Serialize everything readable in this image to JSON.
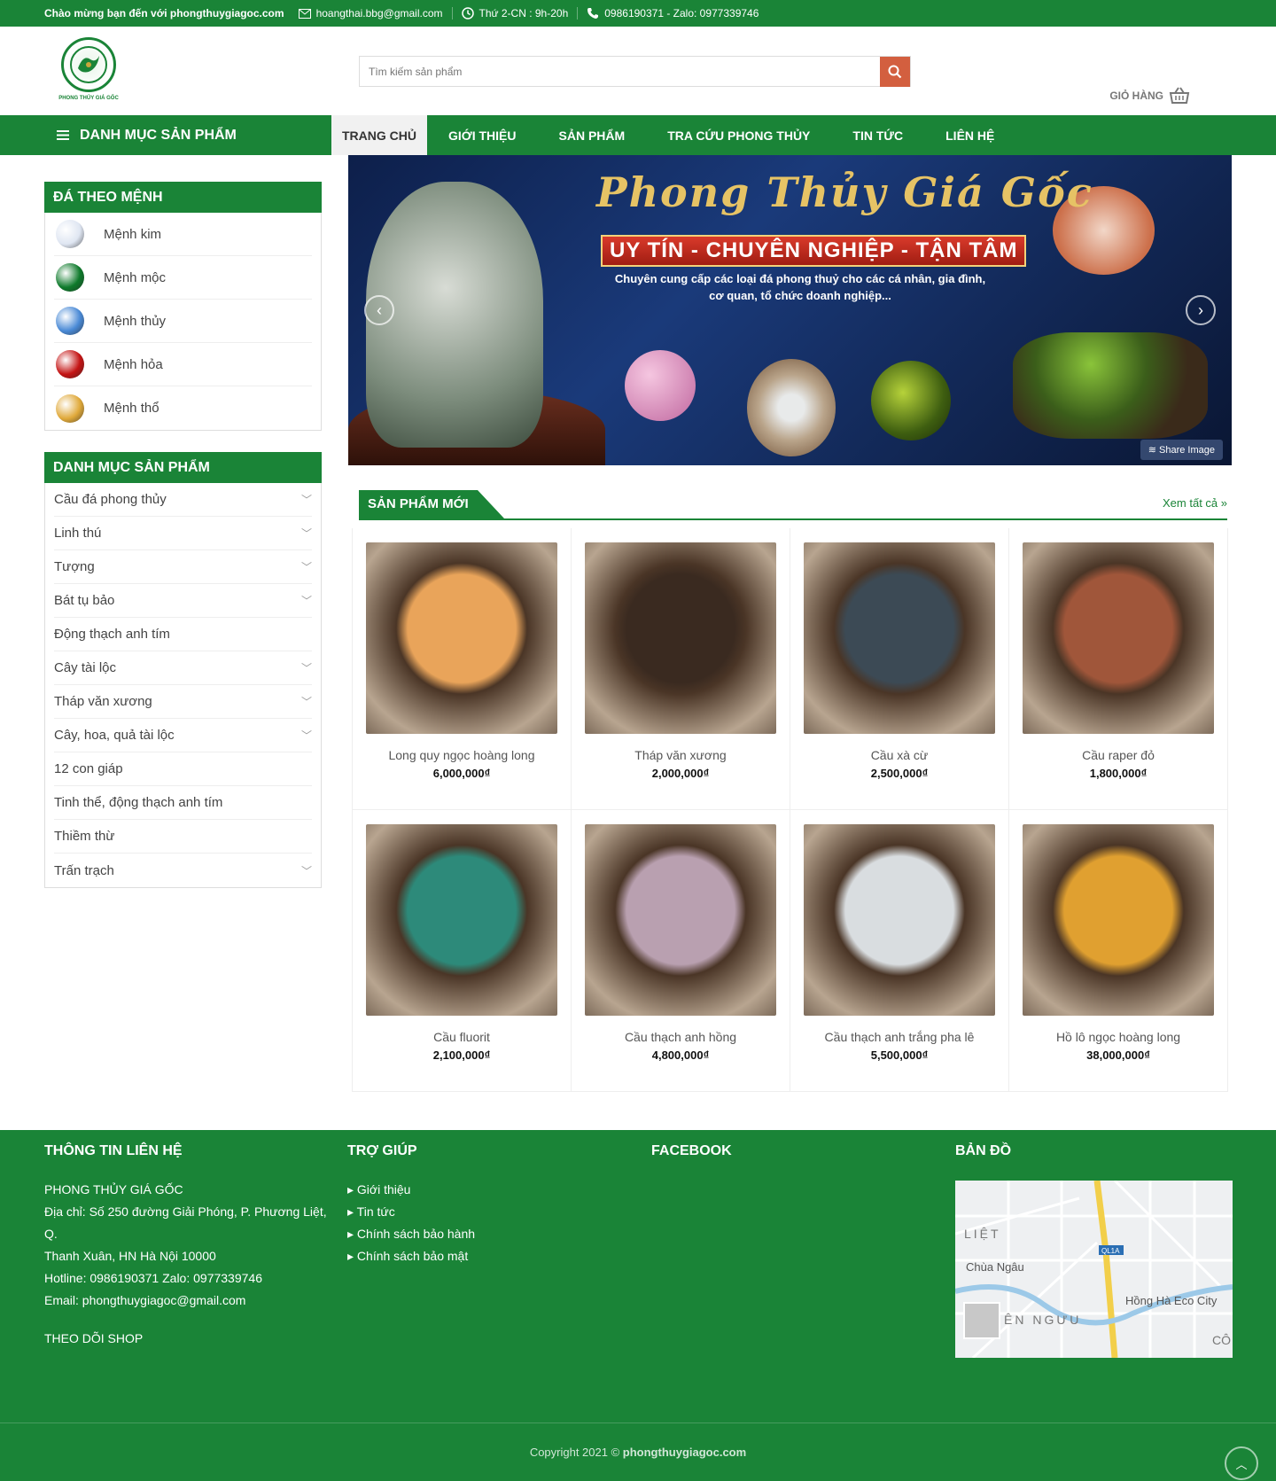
{
  "topbar": {
    "welcome": "Chào mừng bạn đến với phongthuygiagoc.com",
    "email": "hoangthai.bbg@gmail.com",
    "hours": "Thứ 2-CN : 9h-20h",
    "phone": "0986190371 - Zalo: 0977339746"
  },
  "header": {
    "search_placeholder": "Tìm kiếm sản phẩm",
    "cart_label": "GIỎ HÀNG",
    "logo_text": "PHONG THỦY GIÁ GỐC"
  },
  "nav": {
    "category_label": "DANH MỤC SẢN PHẨM",
    "items": [
      "TRANG CHỦ",
      "GIỚI THIỆU",
      "SẢN PHẨM",
      "TRA CỨU PHONG THỦY",
      "TIN TỨC",
      "LIÊN HỆ"
    ]
  },
  "sidebar": {
    "menh_title": "ĐÁ THEO MỆNH",
    "menh": [
      {
        "label": "Mệnh kim",
        "color": "#dfe6f2"
      },
      {
        "label": "Mệnh mộc",
        "color": "#0e7a2b"
      },
      {
        "label": "Mệnh thủy",
        "color": "#4a8ad6"
      },
      {
        "label": "Mệnh hỏa",
        "color": "#c41414"
      },
      {
        "label": "Mệnh thổ",
        "color": "#e0a93a"
      }
    ],
    "cat_title": "DANH MỤC SẢN PHẨM",
    "categories": [
      {
        "label": "Cầu đá phong thủy",
        "expand": true
      },
      {
        "label": "Linh thú",
        "expand": true
      },
      {
        "label": "Tượng",
        "expand": true
      },
      {
        "label": "Bát tụ bảo",
        "expand": true
      },
      {
        "label": "Động thạch anh tím",
        "expand": false
      },
      {
        "label": "Cây tài lộc",
        "expand": true
      },
      {
        "label": "Tháp văn xương",
        "expand": true
      },
      {
        "label": "Cây, hoa, quả tài lộc",
        "expand": true
      },
      {
        "label": "12 con giáp",
        "expand": false
      },
      {
        "label": "Tinh thể, động thạch anh tím",
        "expand": false
      },
      {
        "label": "Thiềm thừ",
        "expand": false
      },
      {
        "label": "Trấn trạch",
        "expand": true
      }
    ]
  },
  "banner": {
    "title": "Phong Thủy Giá Gốc",
    "slogan": "UY TÍN - CHUYÊN NGHIỆP - TẬN TÂM",
    "desc": "Chuyên cung cấp các loại đá phong thuỷ cho các cá nhân, gia đình, cơ quan, tổ chức doanh nghiệp...",
    "share": "Share Image"
  },
  "new_products": {
    "title": "SẢN PHẨM MỚI",
    "see_all": "Xem tất cả »",
    "items": [
      {
        "name": "Long quy ngọc hoàng long",
        "price": "6,000,000₫",
        "color": "#e9a45a"
      },
      {
        "name": "Tháp văn xương",
        "price": "2,000,000₫",
        "color": "#3a2a20"
      },
      {
        "name": "Cầu xà cừ",
        "price": "2,500,000₫",
        "color": "#3c4a55"
      },
      {
        "name": "Cầu raper đỏ",
        "price": "1,800,000₫",
        "color": "#a0563a"
      },
      {
        "name": "Cầu fluorit",
        "price": "2,100,000₫",
        "color": "#2d8a7a"
      },
      {
        "name": "Cầu thạch anh hồng",
        "price": "4,800,000₫",
        "color": "#b9a0b0"
      },
      {
        "name": "Cầu thạch anh trắng pha lê",
        "price": "5,500,000₫",
        "color": "#d9dde0"
      },
      {
        "name": "Hồ lô ngọc hoàng long",
        "price": "38,000,000₫",
        "color": "#e0a030"
      }
    ]
  },
  "footer": {
    "contact_title": "THÔNG TIN LIÊN HỆ",
    "company": "PHONG THỦY GIÁ GỐC",
    "address1": "Địa chỉ: Số 250 đường Giải Phóng, P. Phương Liệt, Q.",
    "address2": "Thanh Xuân, HN Hà Nội 10000",
    "hotline": "Hotline: 0986190371  Zalo: 0977339746",
    "email": "Email: phongthuygiagoc@gmail.com",
    "follow": "THEO DÕI SHOP",
    "help_title": "TRỢ GIÚP",
    "help_links": [
      "Giới thiệu",
      "Tin tức",
      "Chính sách bảo hành",
      "Chính sách bảo mật"
    ],
    "fb_title": "FACEBOOK",
    "map_title": "BẢN ĐỒ",
    "map_labels": {
      "liet": "LIỆT",
      "chua": "Chùa Ngâu",
      "ngu": "ÊN NGƯU",
      "hongha": "Hồng Hà Eco City",
      "ql": "QL1A",
      "co": "CÔ"
    },
    "copyright_prefix": "Copyright 2021 ©",
    "copyright_site": "phongthuygiagoc.com"
  }
}
